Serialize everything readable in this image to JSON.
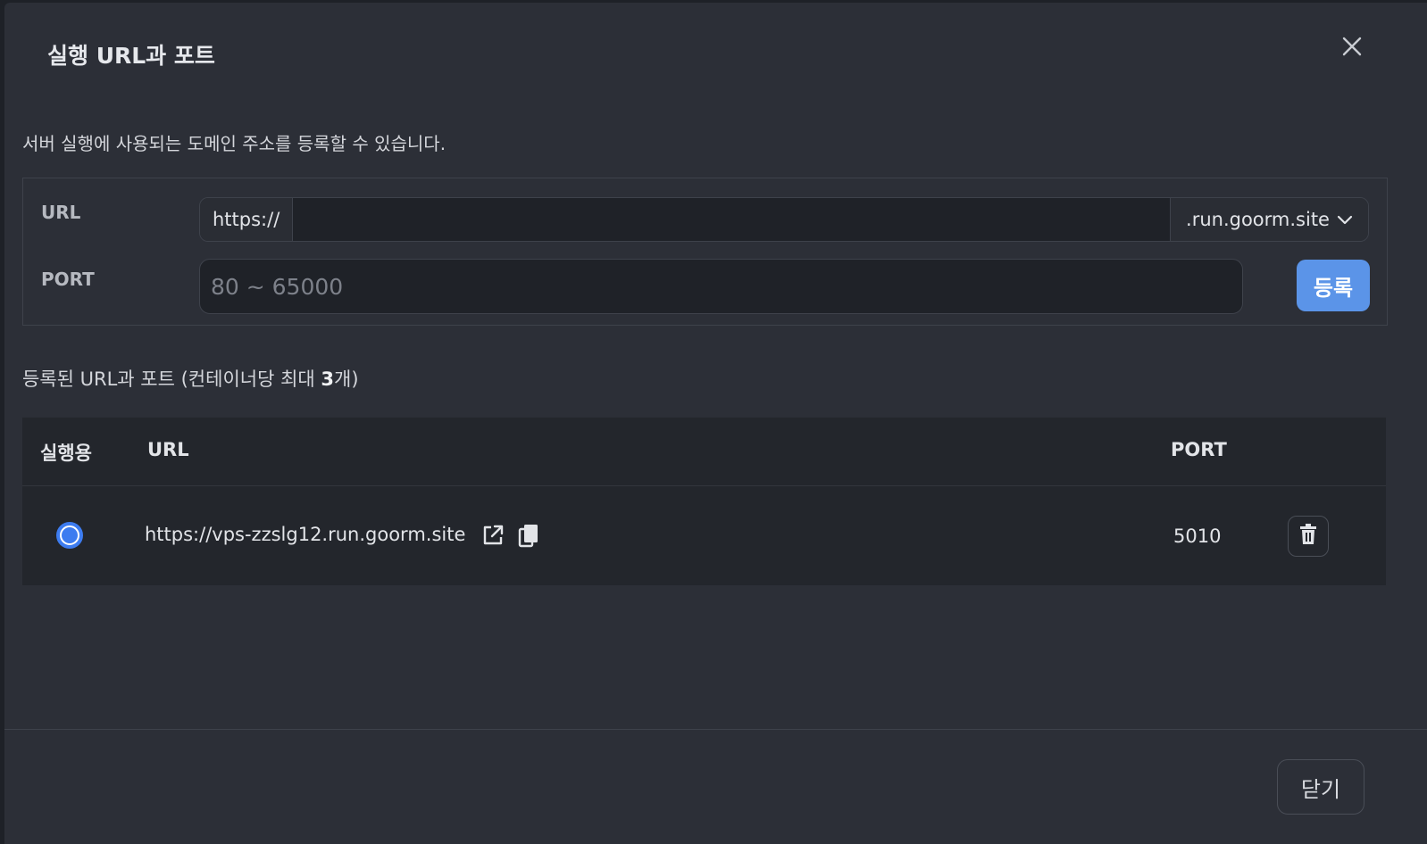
{
  "dialog": {
    "title": "실행 URL과 포트",
    "description": "서버 실행에 사용되는 도메인 주소를 등록할 수 있습니다."
  },
  "form": {
    "url_label": "URL",
    "url_prefix": "https://",
    "url_value": "",
    "domain_selected": ".run.goorm.site",
    "port_label": "PORT",
    "port_placeholder": "80 ~ 65000",
    "port_value": "",
    "register_label": "등록"
  },
  "registered": {
    "heading_prefix": "등록된 URL과 포트 (컨테이너당 최대 ",
    "heading_count": "3",
    "heading_suffix": "개)",
    "columns": {
      "active": "실행용",
      "url": "URL",
      "port": "PORT"
    },
    "rows": [
      {
        "selected": true,
        "url": "https://vps-zzslg12.run.goorm.site",
        "port": "5010"
      }
    ]
  },
  "footer": {
    "close_label": "닫기"
  },
  "colors": {
    "accent": "#5b94e8",
    "radio": "#3d7cf0",
    "dialog_bg": "#2c2f37"
  },
  "icons": [
    "close-icon",
    "chevron-down-icon",
    "external-link-icon",
    "copy-icon",
    "trash-icon"
  ]
}
